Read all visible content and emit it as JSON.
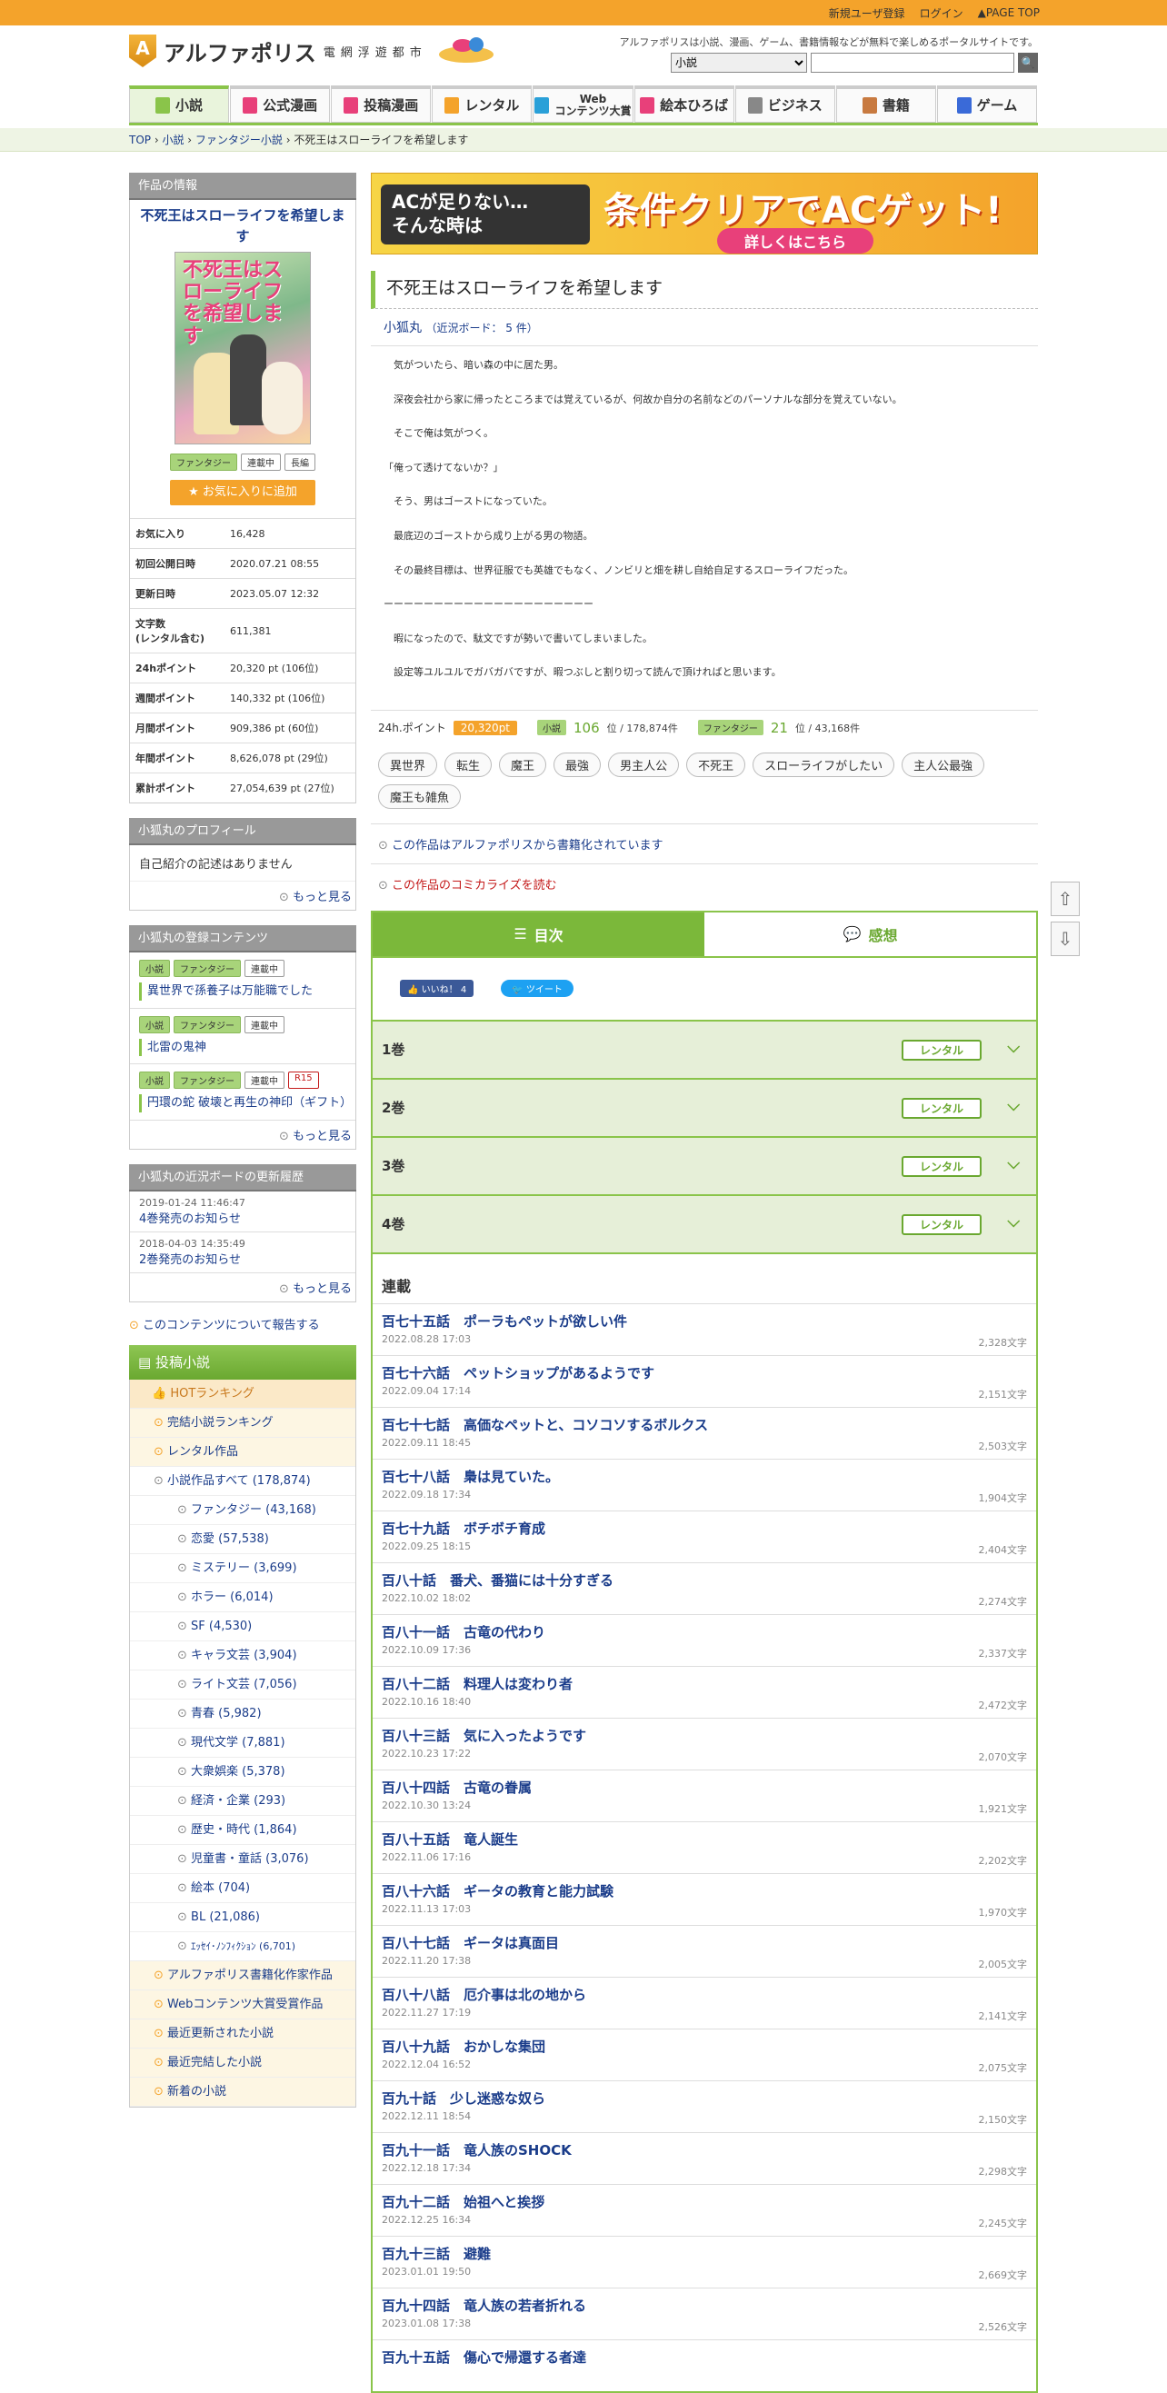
{
  "topbar": {
    "register": "新規ユーザ登録",
    "login": "ログイン",
    "pagetop": "PAGE TOP"
  },
  "header": {
    "logo": "アルファポリス",
    "logo_sub": "電網浮遊都市",
    "tagline": "アルファポリスは小説、漫画、ゲーム、書籍情報などが無料で楽しめるポータルサイトです。",
    "search_select": "小説"
  },
  "nav": [
    {
      "label": "小説",
      "color": "#8ac44a"
    },
    {
      "label": "公式漫画",
      "color": "#e8407a"
    },
    {
      "label": "投稿漫画",
      "color": "#e8407a"
    },
    {
      "label": "レンタル",
      "color": "#f4a32b"
    },
    {
      "label": "Web\nコンテンツ大賞",
      "color": "#2aa0d8"
    },
    {
      "label": "絵本ひろば",
      "color": "#e8407a"
    },
    {
      "label": "ビジネス",
      "color": "#888888"
    },
    {
      "label": "書籍",
      "color": "#c87a40"
    },
    {
      "label": "ゲーム",
      "color": "#3a6ad8"
    }
  ],
  "breadcrumb": {
    "top": "TOP",
    "novel": "小説",
    "fantasy": "ファンタジー小説",
    "current": "不死王はスローライフを希望します"
  },
  "info": {
    "header": "作品の情報",
    "title": "不死王はスローライフを希望します",
    "cover_text": "不死王はスローライフを希望します",
    "tags": [
      "ファンタジー",
      "連載中",
      "長編"
    ],
    "fav_button": "お気に入りに追加",
    "stats": [
      {
        "k": "お気に入り",
        "v": "16,428"
      },
      {
        "k": "初回公開日時",
        "v": "2020.07.21 08:55"
      },
      {
        "k": "更新日時",
        "v": "2023.05.07 12:32"
      },
      {
        "k": "文字数\n(レンタル含む)",
        "v": "611,381"
      },
      {
        "k": "24hポイント",
        "v": "20,320 pt (106位)"
      },
      {
        "k": "週間ポイント",
        "v": "140,332 pt (106位)"
      },
      {
        "k": "月間ポイント",
        "v": "909,386 pt (60位)"
      },
      {
        "k": "年間ポイント",
        "v": "8,626,078 pt (29位)"
      },
      {
        "k": "累計ポイント",
        "v": "27,054,639 pt (27位)"
      }
    ]
  },
  "profile": {
    "header": "小狐丸のプロフィール",
    "text": "自己紹介の記述はありません",
    "more": "もっと見る"
  },
  "contents": {
    "header": "小狐丸の登録コンテンツ",
    "items": [
      {
        "tags": [
          "小説",
          "ファンタジー",
          "連載中"
        ],
        "title": "異世界で孫養子は万能職でした"
      },
      {
        "tags": [
          "小説",
          "ファンタジー",
          "連載中"
        ],
        "title": "北雷の鬼神"
      },
      {
        "tags": [
          "小説",
          "ファンタジー",
          "連載中",
          "R15"
        ],
        "title": "円環の蛇 破壊と再生の神印（ギフト）"
      }
    ],
    "more": "もっと見る"
  },
  "history": {
    "header": "小狐丸の近況ボードの更新履歴",
    "items": [
      {
        "date": "2019-01-24 11:46:47",
        "title": "4巻発売のお知らせ"
      },
      {
        "date": "2018-04-03 14:35:49",
        "title": "2巻発売のお知らせ"
      }
    ],
    "more": "もっと見る"
  },
  "report": "このコンテンツについて報告する",
  "category": {
    "header": "投稿小説",
    "items": [
      {
        "label": "HOTランキング",
        "type": "or"
      },
      {
        "label": "完結小説ランキング",
        "type": "yl"
      },
      {
        "label": "レンタル作品",
        "type": "yl"
      },
      {
        "label": "小説作品すべて (178,874)",
        "type": "mid"
      },
      {
        "label": "ファンタジー (43,168)",
        "type": "sub"
      },
      {
        "label": "恋愛 (57,538)",
        "type": "sub"
      },
      {
        "label": "ミステリー (3,699)",
        "type": "sub"
      },
      {
        "label": "ホラー (6,014)",
        "type": "sub"
      },
      {
        "label": "SF (4,530)",
        "type": "sub"
      },
      {
        "label": "キャラ文芸 (3,904)",
        "type": "sub"
      },
      {
        "label": "ライト文芸 (7,056)",
        "type": "sub"
      },
      {
        "label": "青春 (5,982)",
        "type": "sub"
      },
      {
        "label": "現代文学 (7,881)",
        "type": "sub"
      },
      {
        "label": "大衆娯楽 (5,378)",
        "type": "sub"
      },
      {
        "label": "経済・企業 (293)",
        "type": "sub"
      },
      {
        "label": "歴史・時代 (1,864)",
        "type": "sub"
      },
      {
        "label": "児童書・童話 (3,076)",
        "type": "sub"
      },
      {
        "label": "絵本 (704)",
        "type": "sub"
      },
      {
        "label": "BL (21,086)",
        "type": "sub"
      },
      {
        "label": "ｴｯｾｲ･ﾉﾝﾌｨｸｼｮﾝ (6,701)",
        "type": "sub"
      },
      {
        "label": "アルファポリス書籍化作家作品",
        "type": "yl"
      },
      {
        "label": "Webコンテンツ大賞受賞作品",
        "type": "yl"
      },
      {
        "label": "最近更新された小説",
        "type": "yl"
      },
      {
        "label": "最近完結した小説",
        "type": "yl"
      },
      {
        "label": "新着の小説",
        "type": "yl"
      }
    ]
  },
  "banner": {
    "left": "ACが足りない…\nそんな時は",
    "main": "条件クリアでACゲット!",
    "sub": "詳しくはこちら"
  },
  "work": {
    "title": "不死王はスローライフを希望します",
    "author": "小狐丸",
    "author_board": "（近況ボード： 5 件）",
    "abstract": [
      "気がついたら、暗い森の中に居た男。",
      "深夜会社から家に帰ったところまでは覚えているが、何故か自分の名前などのパーソナルな部分を覚えていない。",
      "そこで俺は気がつく。",
      "「俺って透けてないか？」",
      "そう、男はゴーストになっていた。",
      "最底辺のゴーストから成り上がる男の物語。",
      "その最終目標は、世界征服でも英雄でもなく、ノンビリと畑を耕し自給自足するスローライフだった。",
      "ーーーーーーーーーーーーーーーーーーーーー",
      "暇になったので、駄文ですが勢いで書いてしまいました。",
      "設定等ユルユルでガバガバですが、暇つぶしと割り切って読んで頂ければと思います。"
    ],
    "points": {
      "label": "24h.ポイント",
      "value": "20,320pt",
      "cat1": "小説",
      "rank1": "106",
      "total1": "位 / 178,874件",
      "cat2": "ファンタジー",
      "rank2": "21",
      "total2": "位 / 43,168件"
    },
    "tags": [
      "異世界",
      "転生",
      "魔王",
      "最強",
      "男主人公",
      "不死王",
      "スローライフがしたい",
      "主人公最強",
      "魔王も雑魚"
    ],
    "notice1": "この作品はアルファポリスから書籍化されています",
    "notice2": "この作品のコミカライズを読む"
  },
  "tabs": {
    "toc": "目次",
    "comment": "感想"
  },
  "social": {
    "like": "いいね！ 4",
    "tweet": "ツイート"
  },
  "volumes": [
    {
      "label": "1巻",
      "btn": "レンタル"
    },
    {
      "label": "2巻",
      "btn": "レンタル"
    },
    {
      "label": "3巻",
      "btn": "レンタル"
    },
    {
      "label": "4巻",
      "btn": "レンタル"
    }
  ],
  "serial": {
    "header": "連載",
    "episodes": [
      {
        "t": "百七十五話　ポーラもペットが欲しい件",
        "d": "2022.08.28 17:03",
        "w": "2,328文字"
      },
      {
        "t": "百七十六話　ペットショップがあるようです",
        "d": "2022.09.04 17:14",
        "w": "2,151文字"
      },
      {
        "t": "百七十七話　高価なペットと、コソコソするボルクス",
        "d": "2022.09.11 18:45",
        "w": "2,503文字"
      },
      {
        "t": "百七十八話　梟は見ていた。",
        "d": "2022.09.18 17:34",
        "w": "1,904文字"
      },
      {
        "t": "百七十九話　ボチボチ育成",
        "d": "2022.09.25 18:15",
        "w": "2,404文字"
      },
      {
        "t": "百八十話　番犬、番猫には十分すぎる",
        "d": "2022.10.02 18:02",
        "w": "2,274文字"
      },
      {
        "t": "百八十一話　古竜の代わり",
        "d": "2022.10.09 17:36",
        "w": "2,337文字"
      },
      {
        "t": "百八十二話　料理人は変わり者",
        "d": "2022.10.16 18:40",
        "w": "2,472文字"
      },
      {
        "t": "百八十三話　気に入ったようです",
        "d": "2022.10.23 17:22",
        "w": "2,070文字"
      },
      {
        "t": "百八十四話　古竜の眷属",
        "d": "2022.10.30 13:24",
        "w": "1,921文字"
      },
      {
        "t": "百八十五話　竜人誕生",
        "d": "2022.11.06 17:16",
        "w": "2,202文字"
      },
      {
        "t": "百八十六話　ギータの教育と能力試験",
        "d": "2022.11.13 17:03",
        "w": "1,970文字"
      },
      {
        "t": "百八十七話　ギータは真面目",
        "d": "2022.11.20 17:38",
        "w": "2,005文字"
      },
      {
        "t": "百八十八話　厄介事は北の地から",
        "d": "2022.11.27 17:19",
        "w": "2,141文字"
      },
      {
        "t": "百八十九話　おかしな集団",
        "d": "2022.12.04 16:52",
        "w": "2,075文字"
      },
      {
        "t": "百九十話　少し迷惑な奴ら",
        "d": "2022.12.11 18:54",
        "w": "2,150文字"
      },
      {
        "t": "百九十一話　竜人族のSHOCK",
        "d": "2022.12.18 17:34",
        "w": "2,298文字"
      },
      {
        "t": "百九十二話　始祖へと挨拶",
        "d": "2022.12.25 16:34",
        "w": "2,245文字"
      },
      {
        "t": "百九十三話　避難",
        "d": "2023.01.01 19:50",
        "w": "2,669文字"
      },
      {
        "t": "百九十四話　竜人族の若者折れる",
        "d": "2023.01.08 17:38",
        "w": "2,526文字"
      },
      {
        "t": "百九十五話　傷心で帰還する者達",
        "d": "",
        "w": ""
      }
    ]
  }
}
